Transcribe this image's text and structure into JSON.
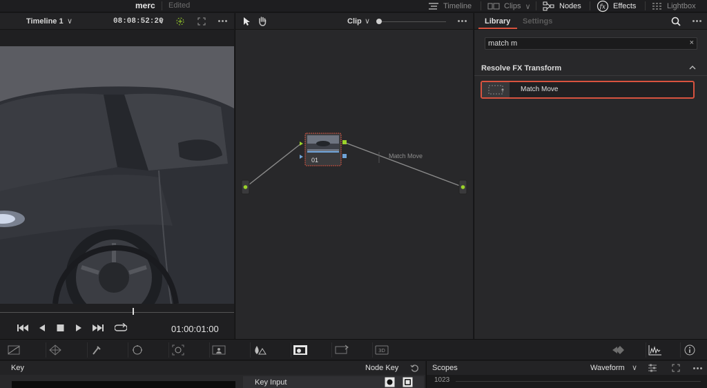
{
  "topbar": {
    "project": "merc",
    "status": "Edited",
    "pages": [
      {
        "label": "Timeline",
        "icon": "timeline-icon",
        "active": false
      },
      {
        "label": "Clips",
        "icon": "clips-icon",
        "active": false
      },
      {
        "label": "Nodes",
        "icon": "nodes-icon",
        "active": true
      },
      {
        "label": "Effects",
        "icon": "fx-icon",
        "active": true
      },
      {
        "label": "Lightbox",
        "icon": "lightbox-icon",
        "active": false
      }
    ]
  },
  "viewer": {
    "timeline_name": "Timeline 1",
    "source_timecode": "08:08:52:20",
    "timecode": "01:00:01:00"
  },
  "node_editor": {
    "mode": "Clip",
    "node_id": "01",
    "effect_label": "Match Move"
  },
  "library": {
    "tabs": [
      "Library",
      "Settings"
    ],
    "search_value": "match m",
    "category": "Resolve FX Transform",
    "items": [
      {
        "label": "Match Move"
      }
    ]
  },
  "key_panel": {
    "title": "Key",
    "node_key_label": "Node Key",
    "key_input_label": "Key Input"
  },
  "scopes": {
    "title": "Scopes",
    "mode": "Waveform",
    "scale_top": "1023"
  },
  "colors": {
    "accent_red": "#d9533f",
    "node_green": "#9bd22a",
    "node_blue": "#6fa3d8"
  }
}
